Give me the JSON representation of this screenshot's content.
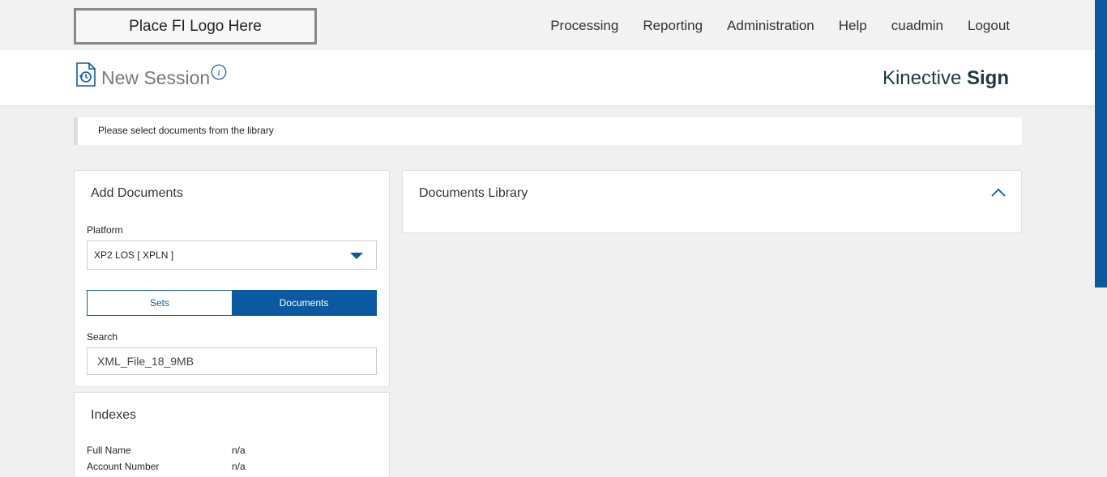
{
  "topbar": {
    "logo_text": "Place FI Logo Here",
    "nav": [
      "Processing",
      "Reporting",
      "Administration",
      "Help",
      "cuadmin",
      "Logout"
    ]
  },
  "header": {
    "title": "New Session",
    "brand_light": "Kinective",
    "brand_bold": "Sign"
  },
  "notice": {
    "text": "Please select documents from the library"
  },
  "add_documents": {
    "title": "Add Documents",
    "platform_label": "Platform",
    "platform_value": "XP2 LOS [ XPLN ]",
    "toggle": {
      "sets": "Sets",
      "documents": "Documents",
      "selected": "Documents"
    },
    "search_label": "Search",
    "search_value": "XML_File_18_9MB"
  },
  "indexes": {
    "title": "Indexes",
    "rows": [
      {
        "label": "Full Name",
        "value": "n/a"
      },
      {
        "label": "Account Number",
        "value": "n/a"
      }
    ]
  },
  "library": {
    "title": "Documents Library"
  },
  "colors": {
    "accent": "#0b5aa1",
    "brand": "#1e3a40"
  },
  "icons": {
    "session": "session-history-icon",
    "info": "info-icon",
    "caret": "chevron-down-icon",
    "collapse": "chevron-up-icon"
  }
}
